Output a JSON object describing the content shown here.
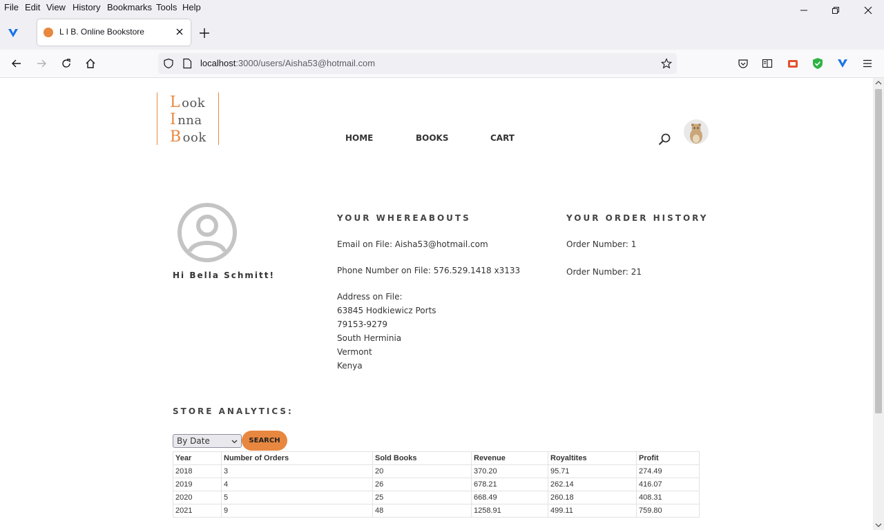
{
  "browser": {
    "menu": [
      "File",
      "Edit",
      "View",
      "History",
      "Bookmarks",
      "Tools",
      "Help"
    ],
    "tab_title": "L I B. Online Bookstore",
    "url_host": "localhost",
    "url_path": ":3000/users/Aisha53@hotmail.com"
  },
  "logo": {
    "lines": [
      {
        "cap": "L",
        "rest": "ook"
      },
      {
        "cap": "I",
        "rest": "nna"
      },
      {
        "cap": "B",
        "rest": "ook"
      }
    ]
  },
  "nav": {
    "home": "HOME",
    "books": "BOOKS",
    "cart": "CART"
  },
  "profile": {
    "greeting": "Hi Bella Schmitt!"
  },
  "whereabouts": {
    "heading": "YOUR WHEREABOUTS",
    "email": "Email on File: Aisha53@hotmail.com",
    "phone": "Phone Number on File: 576.529.1418 x3133",
    "address_label": "Address on File:",
    "address_lines": [
      "63845 Hodkiewicz Ports",
      "79153-9279",
      "South Herminia",
      "Vermont",
      "Kenya"
    ]
  },
  "orders": {
    "heading": "YOUR ORDER HISTORY",
    "items": [
      "Order Number: 1",
      "Order Number: 21"
    ]
  },
  "analytics": {
    "heading": "STORE ANALYTICS:",
    "filter_value": "By Date",
    "search_label": "SEARCH",
    "columns": [
      "Year",
      "Number of Orders",
      "Sold Books",
      "Revenue",
      "Royaltites",
      "Profit"
    ],
    "rows": [
      [
        "2018",
        "3",
        "20",
        "370.20",
        "95.71",
        "274.49"
      ],
      [
        "2019",
        "4",
        "26",
        "678.21",
        "262.14",
        "416.07"
      ],
      [
        "2020",
        "5",
        "25",
        "668.49",
        "260.18",
        "408.31"
      ],
      [
        "2021",
        "9",
        "48",
        "1258.91",
        "499.11",
        "759.80"
      ]
    ]
  },
  "colors": {
    "accent": "#e8873f"
  }
}
